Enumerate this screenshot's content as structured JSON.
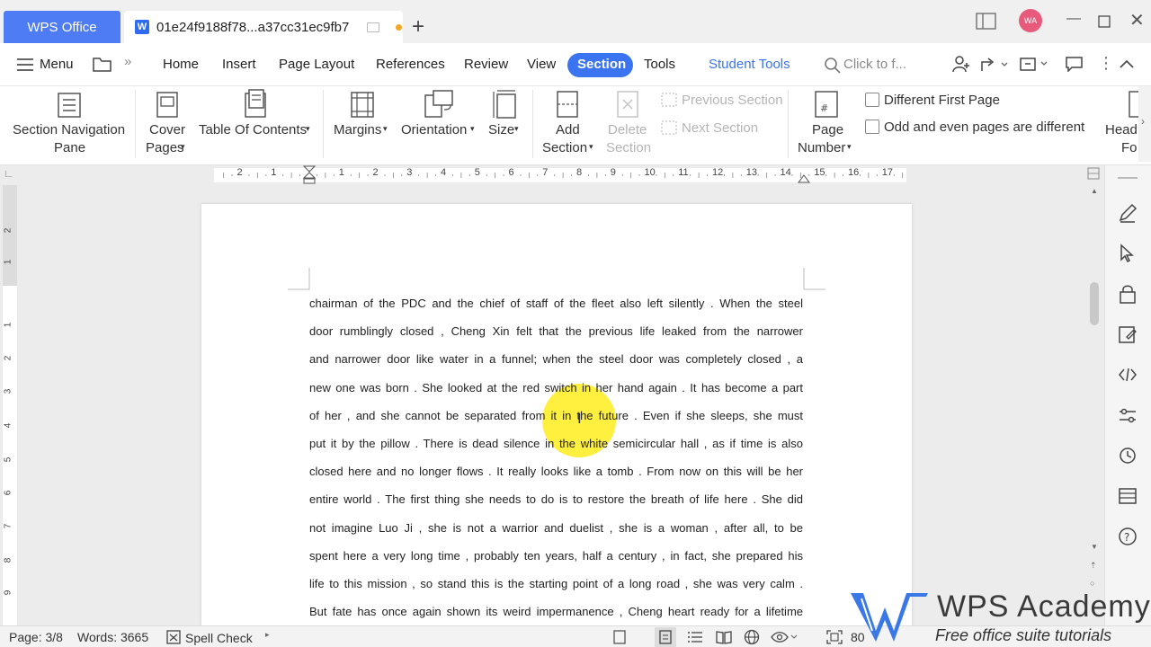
{
  "titlebar": {
    "app_tab": "WPS Office",
    "doc_tab": "01e24f9188f78...a37cc31ec9fb7",
    "avatar": "WA"
  },
  "menubar": {
    "menu_label": "Menu",
    "tabs": [
      "Home",
      "Insert",
      "Page Layout",
      "References",
      "Review",
      "View",
      "Section",
      "Tools"
    ],
    "student_tools": "Student Tools",
    "search_placeholder": "Click to f..."
  },
  "ribbon": {
    "nav_pane": [
      "Section Navigation",
      "Pane"
    ],
    "cover_pages": [
      "Cover",
      "Pages"
    ],
    "toc": "Table Of Contents",
    "margins": "Margins",
    "orientation": "Orientation",
    "size": "Size",
    "add_section": [
      "Add",
      "Section"
    ],
    "delete_section": [
      "Delete",
      "Section"
    ],
    "previous_section": "Previous Section",
    "next_section": "Next Section",
    "page_number": [
      "Page",
      "Number"
    ],
    "different_first_page": "Different First Page",
    "odd_even": "Odd and even pages are different",
    "header_footer": [
      "Head",
      "Fo"
    ]
  },
  "ruler_numbers": [
    "2",
    "1",
    "1",
    "2",
    "3",
    "4",
    "5",
    "6",
    "7",
    "8",
    "9",
    "10",
    "11",
    "12",
    "13",
    "14",
    "15",
    "16",
    "17"
  ],
  "vruler_numbers": [
    "2",
    "1",
    "1",
    "2",
    "3",
    "4",
    "5",
    "6",
    "7",
    "8",
    "9"
  ],
  "document": {
    "lines": [
      "chairman of the PDC and the chief of staff of the fleet also left silently . When the steel",
      "door rumblingly closed , Cheng Xin felt that the previous life leaked from the narrower",
      "and narrower door like water in a funnel; when the steel door was completely closed , a",
      "new one was born . She looked at the red switch in her hand again . It has become a part",
      "of her , and she cannot be separated from it in the future . Even if she sleeps, she must",
      "put it by the pillow . There is dead silence in the white semicircular hall , as if time is also",
      "closed here and no longer flows . It really looks like a tomb . From now on this will be her",
      "entire world . The first thing she needs to do is to restore the breath of life here . She did",
      "not imagine Luo Ji , she is not a warrior and duelist , she is a woman , after all, to be",
      "spent here a very long time , probably ten years, half a century , in fact, she prepared his",
      "life to this mission , so stand this is the starting point of a long road , she was very calm .",
      "But fate has once again shown its weird impermanence , Cheng heart ready for a lifetime"
    ]
  },
  "statusbar": {
    "page": "Page: 3/8",
    "words": "Words: 3665",
    "spell_check": "Spell Check",
    "zoom": "80"
  },
  "watermark": {
    "title": "WPS Academy",
    "subtitle": "Free office suite tutorials"
  },
  "colors": {
    "accent": "#3b74f0",
    "wps_tab": "#4d7cf4",
    "avatar": "#e85a7c",
    "highlight": "#ffeb00"
  }
}
